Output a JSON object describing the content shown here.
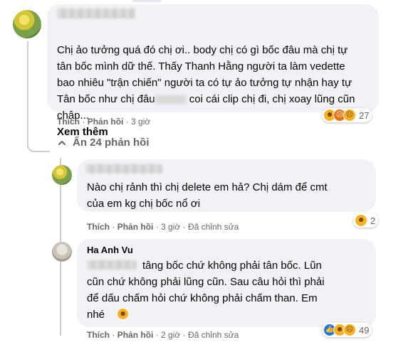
{
  "thread": {
    "main_comment": {
      "text_before_blur": "Chị ảo tưởng quá đó chị ơi.. body chị có gì bốc đâu mà chị tự tân bốc mình dữ thế. Thấy Thanh Hằng người ta làm vedette bao nhiêu \"trận chiến\" người ta có tự ảo tưởng tự nhận hay tự Tân bốc như chị đâu",
      "text_after_blur": " coi cái clip chị đi, chị xoay lũng cũn chập...",
      "see_more": "Xem thêm",
      "like_label": "Thích",
      "reply_label": "Phản hồi",
      "time": "3 giờ",
      "reaction_count": "27",
      "reactions": [
        "haha",
        "angry",
        "sad"
      ]
    },
    "hide_replies": {
      "icon": "chevron-up-icon",
      "label": "Ẩn 24 phản hồi"
    },
    "reply_1": {
      "text": "Nào chị rảnh thì chị delete em hả? Chị dám để cmt\ncủa em kg chị bốc nổ ơi",
      "like_label": "Thích",
      "reply_label": "Phản hồi",
      "time": "3 giờ",
      "edited": "Đã chỉnh sửa",
      "reaction_count": "2",
      "reactions": [
        "haha"
      ]
    },
    "reply_2": {
      "author": "Ha Anh Vu",
      "text": "tâng bốc chứ không phải tân bốc. Lũn\ncũn chứ không phải lũng cũn. Sau câu hỏi thì phải\nđể dấu chấm hỏi chứ không phải chấm than. Em\nnhé",
      "like_label": "Thích",
      "reply_label": "Phản hồi",
      "time": "2 giờ",
      "edited": "Đã chỉnh sửa",
      "reaction_count": "49",
      "reactions": [
        "like",
        "haha",
        "sad"
      ]
    },
    "separator": "·",
    "colors": {
      "bubble": "#f0f2f5",
      "meta": "#65676b",
      "text": "#050505",
      "like_blue": "#1877f2",
      "haha_yellow": "#f7b125"
    }
  }
}
